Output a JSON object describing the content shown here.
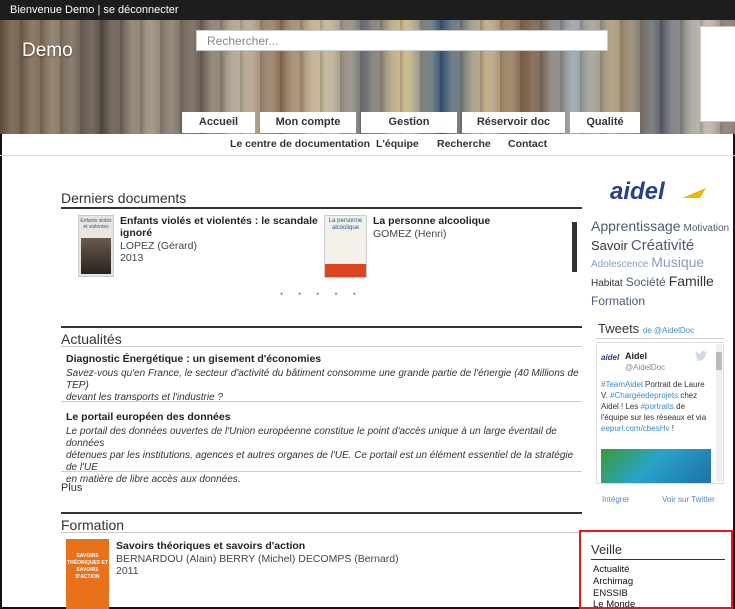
{
  "topbar": {
    "welcome": "Bienvenue Demo | ",
    "logout": "se déconnecter"
  },
  "header": {
    "site_title": "Demo",
    "search_placeholder": "Rechercher..."
  },
  "tabs": [
    "Accueil",
    "Mon compte",
    "Gestion",
    "Réservoir doc",
    "Qualité"
  ],
  "subnav": [
    "Le centre de documentation",
    "L'équipe",
    "Recherche",
    "Contact"
  ],
  "derniers": {
    "title": "Derniers documents",
    "items": [
      {
        "cover_text": "Enfants violés et violentes",
        "title_line1": "Enfants violés et violentés : le scandale",
        "title_line2": "ignoré",
        "author": "LOPEZ (Gérard)",
        "year": "2013"
      },
      {
        "cover_text": "La personne alcoolique",
        "title_line1": "La personne alcoolique",
        "author": "GOMEZ (Henri)"
      }
    ]
  },
  "actualites": {
    "title": "Actualités",
    "items": [
      {
        "title": "Diagnostic Énergétique : un gisement d'économies",
        "line1": "Savez-vous qu'en France, le secteur d'activité du bâtiment consomme une grande partie de l'énergie (40 Millions de TEP)",
        "line2": "devant les transports et l'industrie ?"
      },
      {
        "title": "Le portail européen des données",
        "line1": "Le portail des données ouvertes de l'Union européenne constitue le point d'accès unique à un large éventail de données",
        "line2": "détenues par les institutions, agences et autres organes de l'UE. Ce portail est un élément essentiel de la stratégie de l'UE",
        "line3": "en matière de libre accès aux données."
      }
    ],
    "more": "Plus"
  },
  "formation": {
    "title": "Formation",
    "cover_text": "SAVOIRS THÉORIQUES ET SAVOIRS D'ACTION",
    "item_title": "Savoirs théoriques et savoirs d'action",
    "authors": "BERNARDOU (Alain) BERRY (Michel) DECOMPS (Bernard)",
    "year": "2011"
  },
  "sidebar": {
    "logo": "aidel",
    "tags": [
      "Apprentissage",
      "Motivation",
      "Savoir",
      "Créativité",
      "Adolescence",
      "Musique",
      "Habitat",
      "Société",
      "Famille",
      "Formation"
    ],
    "tweets": {
      "heading": "Tweets",
      "by": "de @AidelDoc",
      "name": "Aidel",
      "handle": "@AidelDoc",
      "text_a": "#TeamAidel",
      "text_b": " Portrait de Laure V. ",
      "text_c": "#Chargéedeprojets",
      "text_d": " chez Aidel ! Les ",
      "text_e": "#portraits",
      "text_f": " de l'équipe sur les réseaux et via ",
      "text_g": "eepurl.com/cbesHv",
      "text_h": " !",
      "embed": "Intégrer",
      "view": "Voir sur Twitter"
    },
    "veille": {
      "title": "Veille",
      "items": [
        "Actualité",
        "Archimag",
        "ENSSIB",
        "Le Monde"
      ]
    }
  },
  "colors": {
    "topbar": "#1d1d1d",
    "accent_blue": "#27408b",
    "tag_blue": "#4a5a78",
    "twitter_link": "#3a8cc9",
    "highlight_red": "#e51919"
  }
}
